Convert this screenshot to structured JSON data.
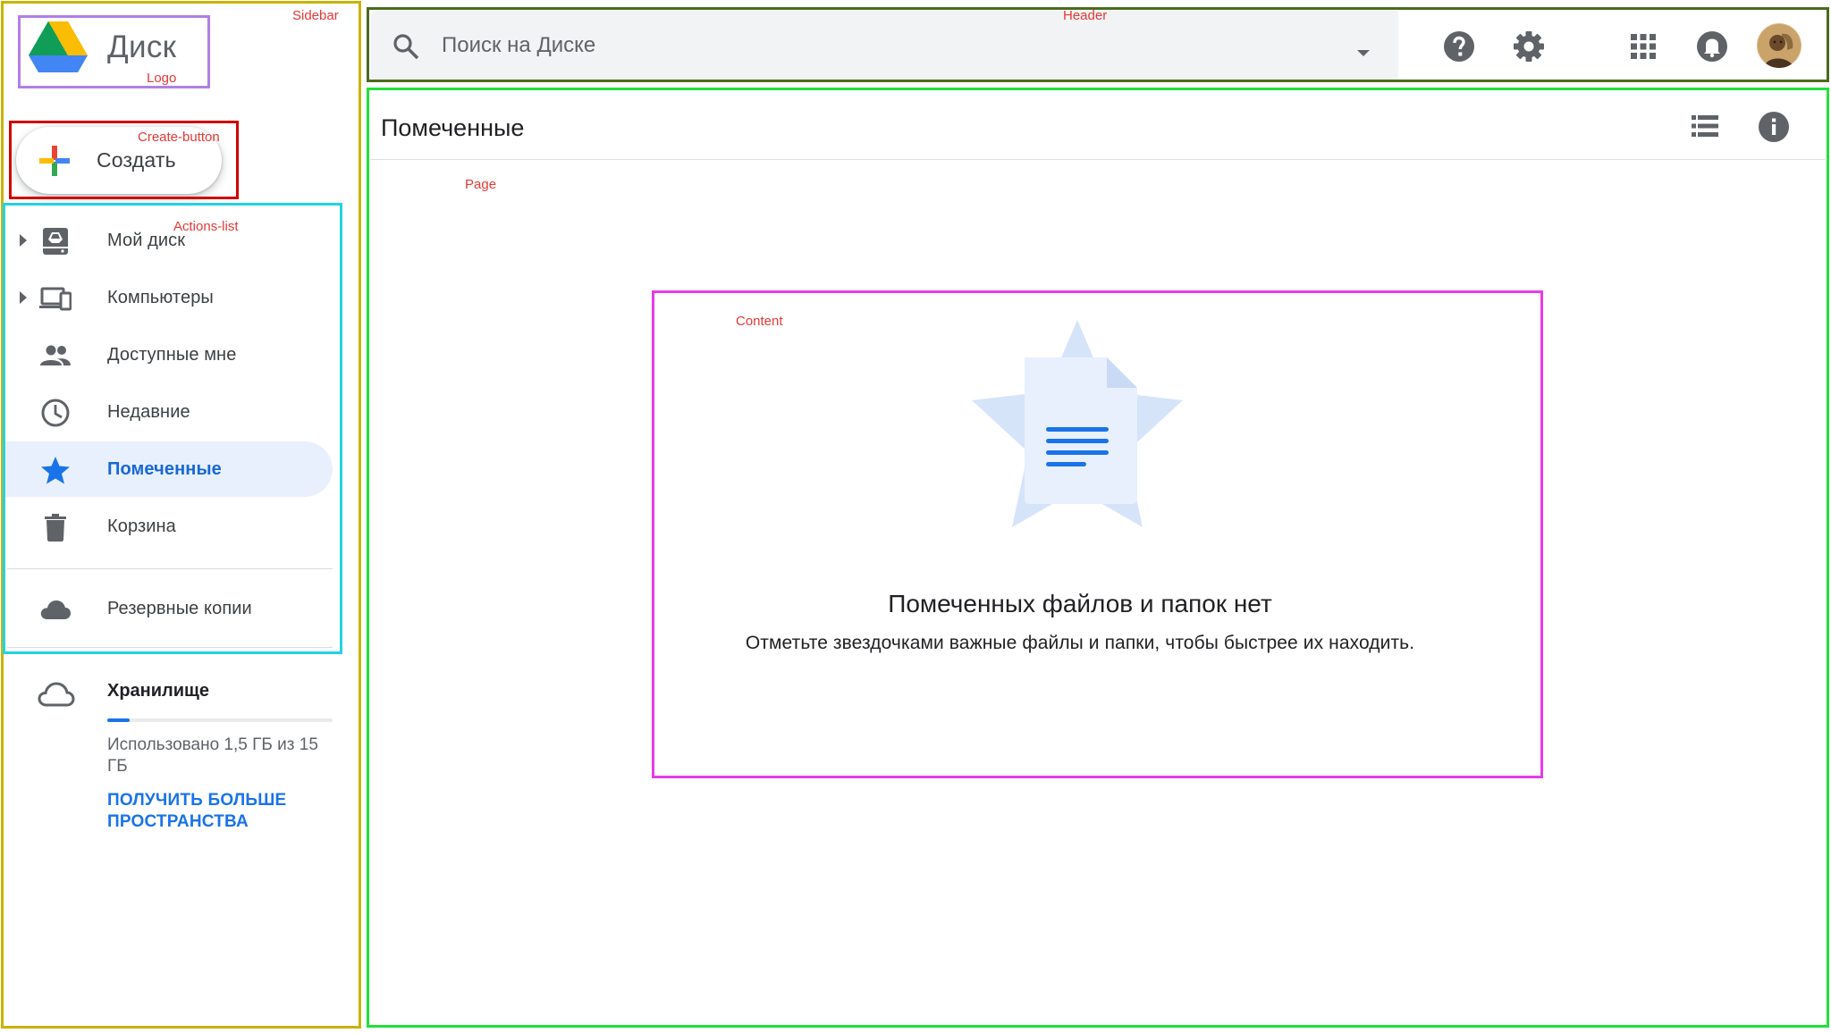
{
  "annotations": {
    "sidebar": "Sidebar",
    "logo": "Logo",
    "create_button": "Create-button",
    "actions_list": "Actions-list",
    "header": "Header",
    "page": "Page",
    "content": "Content"
  },
  "app": {
    "name": "Диск"
  },
  "create": {
    "label": "Создать"
  },
  "sidebar": {
    "items": [
      {
        "label": "Мой диск",
        "icon": "my-drive-icon",
        "expandable": true
      },
      {
        "label": "Компьютеры",
        "icon": "computers-icon",
        "expandable": true
      },
      {
        "label": "Доступные мне",
        "icon": "shared-people-icon",
        "expandable": false
      },
      {
        "label": "Недавние",
        "icon": "clock-icon",
        "expandable": false
      },
      {
        "label": "Помеченные",
        "icon": "star-icon",
        "expandable": false,
        "active": true
      },
      {
        "label": "Корзина",
        "icon": "trash-icon",
        "expandable": false
      },
      {
        "label": "Резервные копии",
        "icon": "cloud-icon",
        "expandable": false
      }
    ]
  },
  "storage": {
    "title": "Хранилище",
    "used_text": "Использовано 1,5 ГБ из 15 ГБ",
    "used_fraction": 0.1,
    "more_link": "ПОЛУЧИТЬ БОЛЬШЕ ПРОСТРАНСТВА"
  },
  "search": {
    "placeholder": "Поиск на Диске"
  },
  "header_icons": [
    "help-icon",
    "settings-gear-icon",
    "apps-grid-icon",
    "notifications-bell-icon"
  ],
  "page": {
    "title": "Помеченные"
  },
  "empty_state": {
    "title": "Помеченных файлов и папок нет",
    "subtitle": "Отметьте звездочками важные файлы и папки, чтобы быстрее их находить."
  },
  "colors": {
    "accent": "#1a73e8",
    "active_bg": "#e8f0fe",
    "active_text": "#1967d2",
    "anno_sidebar": "#c8b400",
    "anno_logo": "#b07fe8",
    "anno_create": "#d00000",
    "anno_actions": "#22d3e6",
    "anno_header": "#4a6b1e",
    "anno_page": "#22e03a",
    "anno_content": "#e83ae8"
  }
}
